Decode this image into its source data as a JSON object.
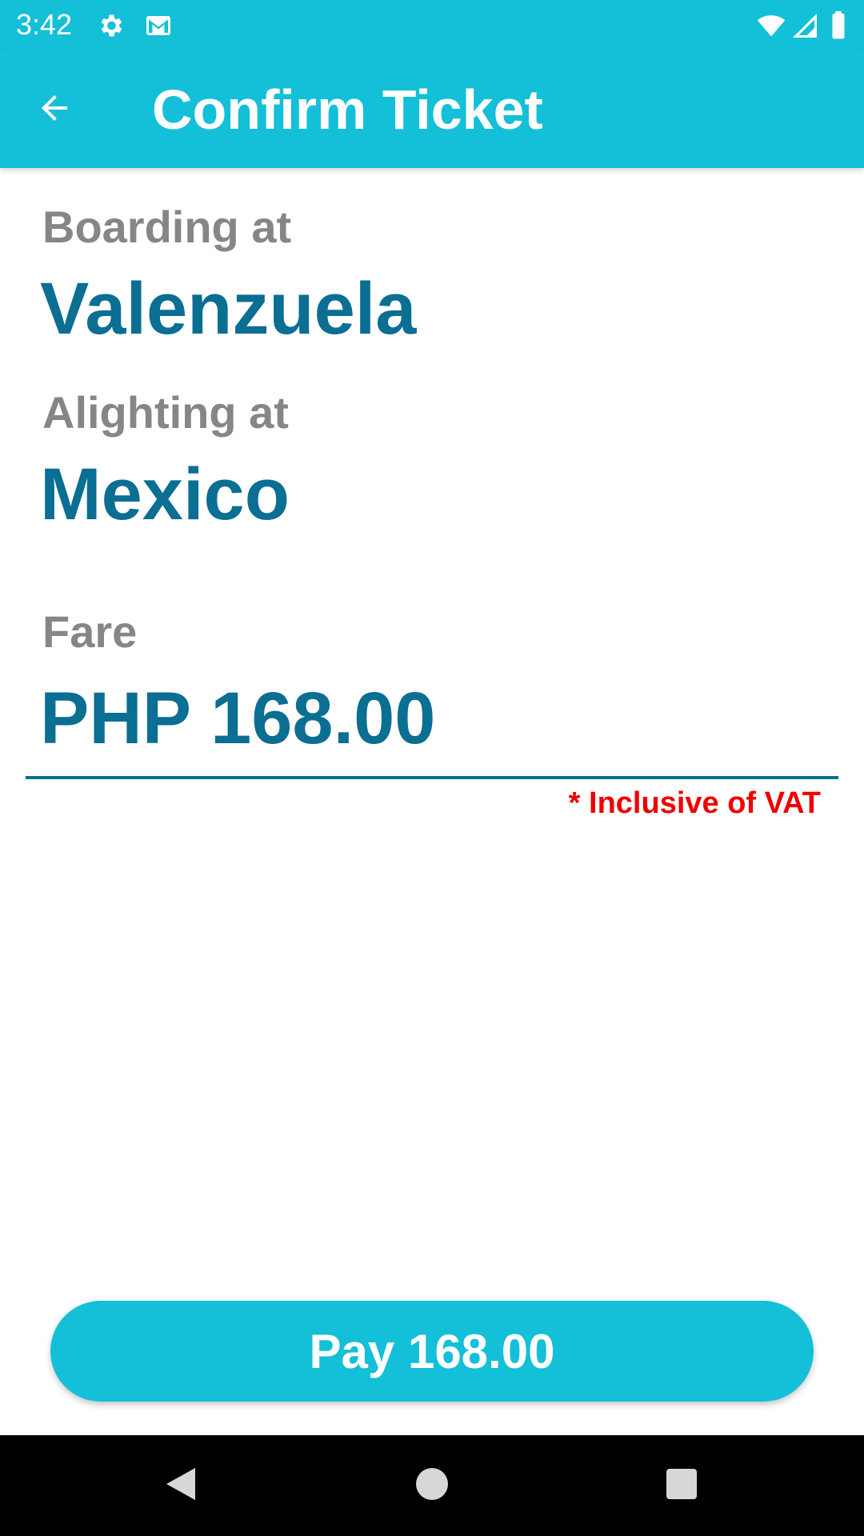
{
  "status_bar": {
    "time": "3:42",
    "icons": [
      "settings-icon",
      "gmail-icon",
      "wifi-icon",
      "cell-signal-icon",
      "battery-icon"
    ]
  },
  "app_bar": {
    "title": "Confirm Ticket",
    "back_icon": "arrow-back-icon"
  },
  "ticket": {
    "boarding_label": "Boarding at",
    "boarding_value": "Valenzuela",
    "alighting_label": "Alighting at",
    "alighting_value": "Mexico",
    "fare_label": "Fare",
    "fare_value": "PHP 168.00",
    "vat_note": "* Inclusive of VAT"
  },
  "actions": {
    "pay_label": "Pay 168.00"
  },
  "nav_bar": {
    "icons": [
      "back-triangle-icon",
      "home-circle-icon",
      "recents-square-icon"
    ]
  },
  "colors": {
    "primary": "#14BFD8",
    "value_text": "#0B6E93",
    "label_text": "#868686",
    "warning_text": "#EE0000"
  }
}
